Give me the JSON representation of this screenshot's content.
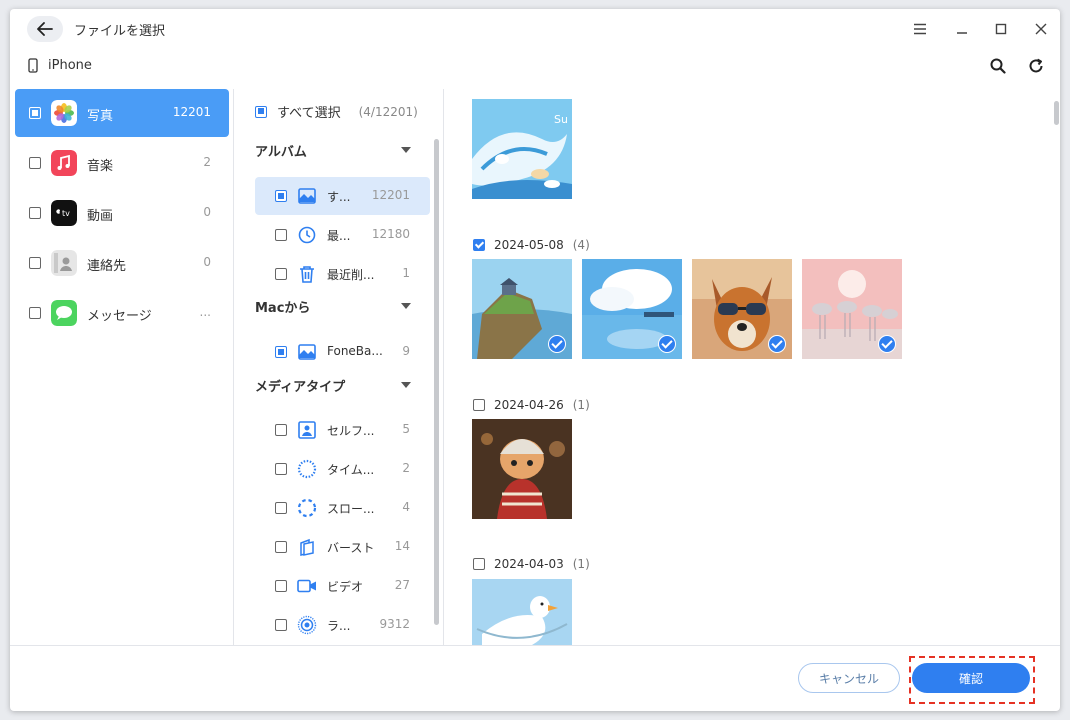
{
  "window": {
    "title": "ファイルを選択"
  },
  "device": {
    "name": "iPhone"
  },
  "categories": [
    {
      "label": "写真",
      "count": "12201"
    },
    {
      "label": "音楽",
      "count": "2"
    },
    {
      "label": "動画",
      "count": "0"
    },
    {
      "label": "連絡先",
      "count": "0"
    },
    {
      "label": "メッセージ",
      "count": "..."
    }
  ],
  "select_all": {
    "label": "すべて選択",
    "count": "(4/12201)"
  },
  "sections": {
    "album": "アルバム",
    "mac": "Macから",
    "media": "メディアタイプ"
  },
  "albums": [
    {
      "label": "す...",
      "count": "12201"
    },
    {
      "label": "最...",
      "count": "12180"
    },
    {
      "label": "最近削...",
      "count": "1"
    }
  ],
  "mac_albums": [
    {
      "label": "FoneBa...",
      "count": "9"
    }
  ],
  "media_types": [
    {
      "label": "セルフ...",
      "count": "5"
    },
    {
      "label": "タイム...",
      "count": "2"
    },
    {
      "label": "スロー...",
      "count": "4"
    },
    {
      "label": "バースト",
      "count": "14"
    },
    {
      "label": "ビデオ",
      "count": "27"
    },
    {
      "label": "ラ...",
      "count": "9312"
    }
  ],
  "date_groups": [
    {
      "date": "2024-05-08",
      "count": "(4)"
    },
    {
      "date": "2024-04-26",
      "count": "(1)"
    },
    {
      "date": "2024-04-03",
      "count": "(1)"
    }
  ],
  "thumb_text": {
    "wave": "Su"
  },
  "footer": {
    "cancel": "キャンセル",
    "confirm": "確認"
  },
  "colors": {
    "accent": "#2f7ff0",
    "active_category": "#4a9cf6",
    "highlight": "#e53224"
  }
}
